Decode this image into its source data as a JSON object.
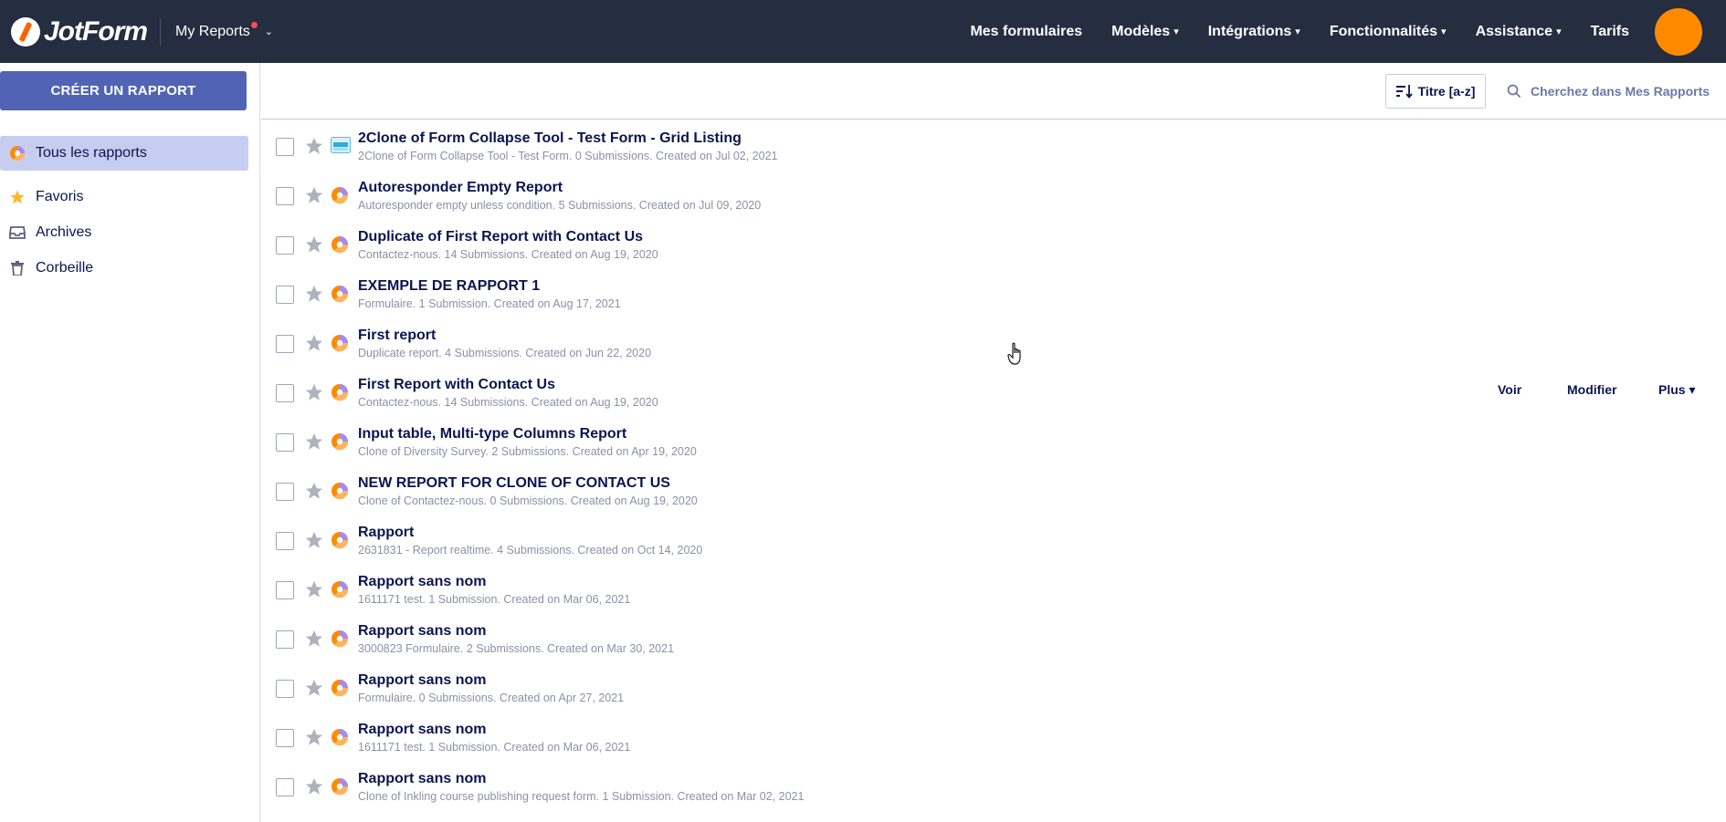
{
  "brand": {
    "name": "JotForm"
  },
  "header": {
    "context_label": "My Reports",
    "nav": [
      {
        "label": "Mes formulaires",
        "caret": false
      },
      {
        "label": "Modèles",
        "caret": true
      },
      {
        "label": "Intégrations",
        "caret": true
      },
      {
        "label": "Fonctionnalités",
        "caret": true
      },
      {
        "label": "Assistance",
        "caret": true
      },
      {
        "label": "Tarifs",
        "caret": false
      }
    ]
  },
  "sidebar": {
    "create_label": "CRÉER UN RAPPORT",
    "items": [
      {
        "label": "Tous les rapports",
        "icon": "pie-chart-icon",
        "active": true
      },
      {
        "label": "Favoris",
        "icon": "star-icon",
        "active": false
      },
      {
        "label": "Archives",
        "icon": "archive-icon",
        "active": false
      },
      {
        "label": "Corbeille",
        "icon": "trash-icon",
        "active": false
      }
    ]
  },
  "toolbar": {
    "sort_label": "Titre [a-z]",
    "search_placeholder": "Cherchez dans Mes Rapports"
  },
  "row_actions": {
    "view": "Voir",
    "edit": "Modifier",
    "more": "Plus ▾"
  },
  "colors": {
    "topbar": "#252d40",
    "accent": "#5163b5",
    "active_bg": "#c7cdf0",
    "avatar": "#ff8a00"
  },
  "reports": [
    {
      "title": "2Clone of Form Collapse Tool - Test Form - Grid Listing",
      "subtitle": "2Clone of Form Collapse Tool - Test Form. 0 Submissions. Created on Jul 02, 2021",
      "icon": "grid-report-icon",
      "hover": false
    },
    {
      "title": "Autoresponder Empty Report",
      "subtitle": "Autoresponder empty unless condition. 5 Submissions. Created on Jul 09, 2020",
      "icon": "pie-report-icon",
      "hover": false
    },
    {
      "title": "Duplicate of First Report with Contact Us",
      "subtitle": "Contactez-nous. 14 Submissions. Created on Aug 19, 2020",
      "icon": "pie-report-icon",
      "hover": false
    },
    {
      "title": "EXEMPLE DE RAPPORT 1",
      "subtitle": "Formulaire. 1 Submission. Created on Aug 17, 2021",
      "icon": "pie-report-icon",
      "hover": false
    },
    {
      "title": "First report",
      "subtitle": "Duplicate report. 4 Submissions. Created on Jun 22, 2020",
      "icon": "pie-report-icon",
      "hover": false
    },
    {
      "title": "First Report with Contact Us",
      "subtitle": "Contactez-nous. 14 Submissions. Created on Aug 19, 2020",
      "icon": "pie-report-icon",
      "hover": true
    },
    {
      "title": "Input table, Multi-type Columns Report",
      "subtitle": "Clone of Diversity Survey. 2 Submissions. Created on Apr 19, 2020",
      "icon": "pie-report-icon",
      "hover": false
    },
    {
      "title": "NEW REPORT FOR CLONE OF CONTACT US",
      "subtitle": "Clone of Contactez-nous. 0 Submissions. Created on Aug 19, 2020",
      "icon": "pie-report-icon",
      "hover": false
    },
    {
      "title": "Rapport",
      "subtitle": "2631831 - Report realtime. 4 Submissions. Created on Oct 14, 2020",
      "icon": "pie-report-icon",
      "hover": false
    },
    {
      "title": "Rapport sans nom",
      "subtitle": "1611171 test. 1 Submission. Created on Mar 06, 2021",
      "icon": "pie-report-icon",
      "hover": false
    },
    {
      "title": "Rapport sans nom",
      "subtitle": "3000823 Formulaire. 2 Submissions. Created on Mar 30, 2021",
      "icon": "pie-report-icon",
      "hover": false
    },
    {
      "title": "Rapport sans nom",
      "subtitle": "Formulaire. 0 Submissions. Created on Apr 27, 2021",
      "icon": "pie-report-icon",
      "hover": false
    },
    {
      "title": "Rapport sans nom",
      "subtitle": "1611171 test. 1 Submission. Created on Mar 06, 2021",
      "icon": "pie-report-icon",
      "hover": false
    },
    {
      "title": "Rapport sans nom",
      "subtitle": "Clone of Inkling course publishing request form. 1 Submission. Created on Mar 02, 2021",
      "icon": "pie-report-icon",
      "hover": false
    }
  ]
}
